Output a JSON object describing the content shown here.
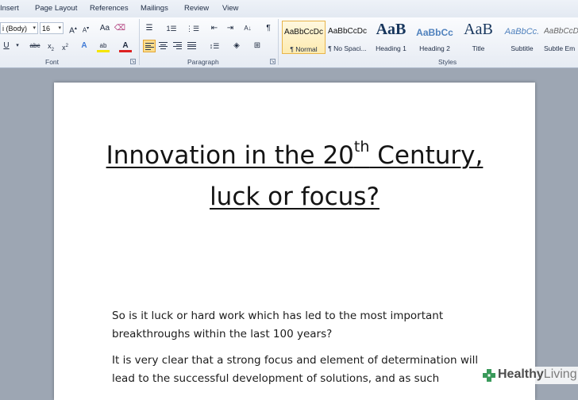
{
  "ribbon_tabs": [
    "Insert",
    "Page Layout",
    "References",
    "Mailings",
    "Review",
    "View"
  ],
  "font": {
    "name": "i (Body)",
    "size": "16",
    "group_label": "Font"
  },
  "paragraph": {
    "group_label": "Paragraph"
  },
  "styles": {
    "group_label": "Styles",
    "items": [
      {
        "preview": "AaBbCcDc",
        "label": "¶ Normal"
      },
      {
        "preview": "AaBbCcDc",
        "label": "¶ No Spaci..."
      },
      {
        "preview": "AaB",
        "label": "Heading 1"
      },
      {
        "preview": "AaBbCc",
        "label": "Heading 2"
      },
      {
        "preview": "AaB",
        "label": "Title"
      },
      {
        "preview": "AaBbCc.",
        "label": "Subtitle"
      },
      {
        "preview": "AaBbCcDc",
        "label": "Subtle Em"
      }
    ]
  },
  "document": {
    "title_line1_a": "Innovation in the 20",
    "title_line1_sup": "th",
    "title_line1_b": " Century,",
    "title_line2": "luck or focus?",
    "body_lines": [
      "So is it luck or hard work which has led to the most important",
      "breakthroughs  within the last 100 years?",
      "It is very clear that a strong focus and element of determination  will",
      "lead to the successful development  of solutions, and as such"
    ]
  },
  "watermark": {
    "brand_a": "Healthy",
    "brand_b": "Living"
  },
  "colors": {
    "accent": "#2a5699",
    "selected_style": "#fbdd8e",
    "doc_background": "#9da6b3"
  }
}
